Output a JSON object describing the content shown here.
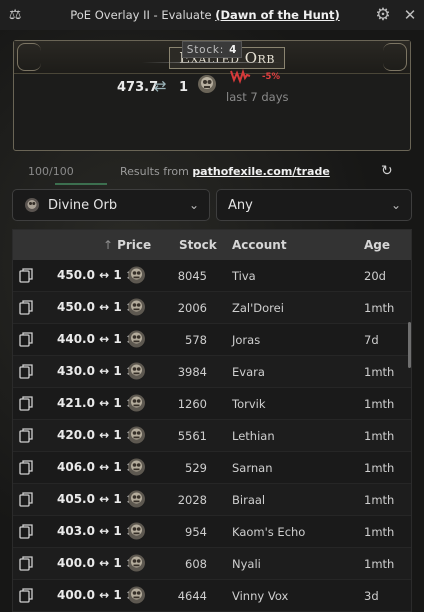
{
  "window": {
    "title_prefix": "PoE Overlay II - Evaluate ",
    "league": "(Dawn of the Hunt)",
    "app_icon": "scale-icon",
    "settings_icon": "gear-icon",
    "close_icon": "close-icon"
  },
  "item": {
    "name": "Exalted Orb",
    "stock_label": "Stock:",
    "stock_value": "4",
    "rate_left": "473.7",
    "rate_right": "1",
    "change": "-5%",
    "period": "last 7 days"
  },
  "results": {
    "count": "100/100",
    "prefix": "Results from ",
    "source": "pathofexile.com/trade"
  },
  "filters": {
    "currency": "Divine Orb",
    "mode": "Any"
  },
  "table": {
    "headers": {
      "price": "Price",
      "stock": "Stock",
      "account": "Account",
      "age": "Age"
    },
    "rows": [
      {
        "price": "450.0",
        "ratio": "↔ 1 ×",
        "stock": "8045",
        "account": "Tiva",
        "age": "20d"
      },
      {
        "price": "450.0",
        "ratio": "↔ 1 ×",
        "stock": "2006",
        "account": "Zal'Dorei",
        "age": "1mth"
      },
      {
        "price": "440.0",
        "ratio": "↔ 1 ×",
        "stock": "578",
        "account": "Joras",
        "age": "7d"
      },
      {
        "price": "430.0",
        "ratio": "↔ 1 ×",
        "stock": "3984",
        "account": "Evara",
        "age": "1mth"
      },
      {
        "price": "421.0",
        "ratio": "↔ 1 ×",
        "stock": "1260",
        "account": "Torvik",
        "age": "1mth"
      },
      {
        "price": "420.0",
        "ratio": "↔ 1 ×",
        "stock": "5561",
        "account": "Lethian",
        "age": "1mth"
      },
      {
        "price": "406.0",
        "ratio": "↔ 1 ×",
        "stock": "529",
        "account": "Sarnan",
        "age": "1mth"
      },
      {
        "price": "405.0",
        "ratio": "↔ 1 ×",
        "stock": "2028",
        "account": "Biraal",
        "age": "1mth"
      },
      {
        "price": "403.0",
        "ratio": "↔ 1 ×",
        "stock": "954",
        "account": "Kaom's Echo",
        "age": "1mth"
      },
      {
        "price": "400.0",
        "ratio": "↔ 1 ×",
        "stock": "608",
        "account": "Nyali",
        "age": "1mth"
      },
      {
        "price": "400.0",
        "ratio": "↔ 1 ×",
        "stock": "4644",
        "account": "Vinny Vox",
        "age": "3d"
      }
    ]
  },
  "colors": {
    "accent": "#3c6f4f",
    "negative": "#e04040",
    "gold_border": "#8a8470"
  }
}
